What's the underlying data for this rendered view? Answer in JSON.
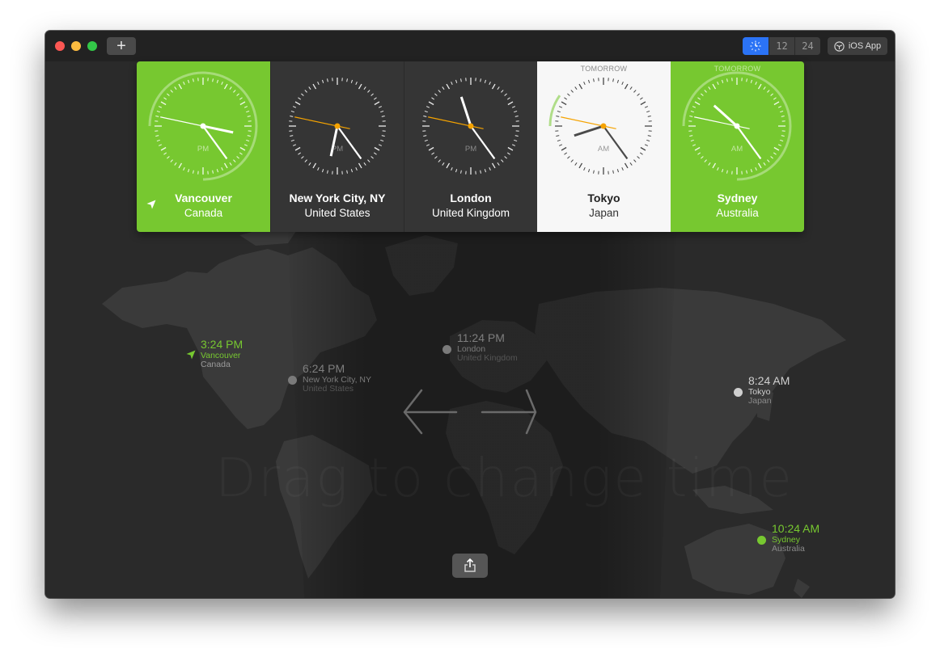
{
  "titlebar": {
    "add_label": "+",
    "mode_segments": [
      {
        "name": "analog",
        "label": "",
        "icon": "clock-icon",
        "selected": true
      },
      {
        "name": "12h",
        "label": "12",
        "selected": false
      },
      {
        "name": "24h",
        "label": "24",
        "selected": false
      }
    ],
    "ios_app_label": "iOS App"
  },
  "accent_color": "#77c830",
  "cards": [
    {
      "city": "Vancouver",
      "country": "Canada",
      "tomorrow": "",
      "ampm": "PM",
      "theme": "green",
      "current_location": true,
      "hour": 3,
      "minute": 24,
      "second": 47,
      "daylight_arc": [
        -90,
        180
      ]
    },
    {
      "city": "New York City, NY",
      "country": "United States",
      "tomorrow": "",
      "ampm": "PM",
      "theme": "dark",
      "current_location": false,
      "hour": 6,
      "minute": 24,
      "second": 47
    },
    {
      "city": "London",
      "country": "United Kingdom",
      "tomorrow": "",
      "ampm": "PM",
      "theme": "dark",
      "current_location": false,
      "hour": 11,
      "minute": 24,
      "second": 47
    },
    {
      "city": "Tokyo",
      "country": "Japan",
      "tomorrow": "TOMORROW",
      "ampm": "AM",
      "theme": "light",
      "current_location": false,
      "hour": 8,
      "minute": 24,
      "second": 47,
      "daylight_arc": [
        -90,
        -55
      ]
    },
    {
      "city": "Sydney",
      "country": "Australia",
      "tomorrow": "TOMORROW",
      "ampm": "AM",
      "theme": "green",
      "current_location": false,
      "hour": 10,
      "minute": 24,
      "second": 47,
      "daylight_arc": [
        -90,
        180
      ]
    }
  ],
  "map_pins": [
    {
      "time": "3:24 PM",
      "city": "Vancouver",
      "country": "Canada",
      "style": "home"
    },
    {
      "time": "6:24 PM",
      "city": "New York City, NY",
      "country": "United States",
      "style": "night"
    },
    {
      "time": "11:24 PM",
      "city": "London",
      "country": "United Kingdom",
      "style": "night"
    },
    {
      "time": "8:24 AM",
      "city": "Tokyo",
      "country": "Japan",
      "style": "day"
    },
    {
      "time": "10:24 AM",
      "city": "Sydney",
      "country": "Australia",
      "style": "green"
    }
  ],
  "watermark": "Drag to change time",
  "share_icon": "share-icon"
}
